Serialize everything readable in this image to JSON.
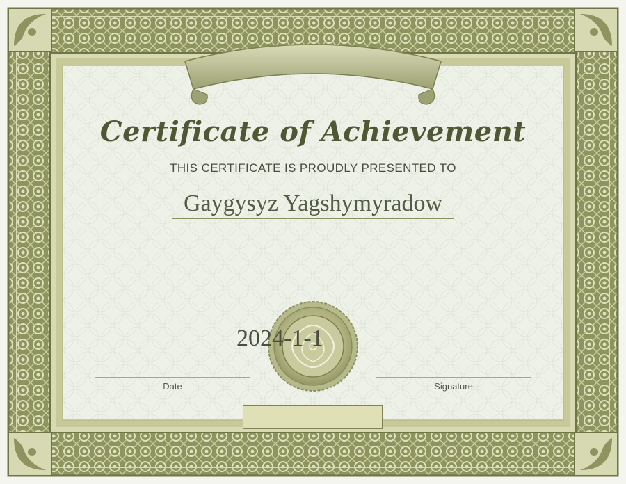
{
  "certificate": {
    "title": "Certificate of Achievement",
    "subtitle": "THIS CERTIFICATE IS PROUDLY PRESENTED TO",
    "recipient": "Gaygysyz Yagshymyradow",
    "date_value": "2024-1-1",
    "date_label": "Date",
    "signature_label": "Signature"
  },
  "colors": {
    "border_dark": "#7e8552",
    "border_light": "#cfd2a6",
    "paper": "#eef1e8",
    "ink": "#4f5734"
  },
  "icons": [
    "ribbon-banner",
    "seal-emblem",
    "corner-ornament"
  ]
}
